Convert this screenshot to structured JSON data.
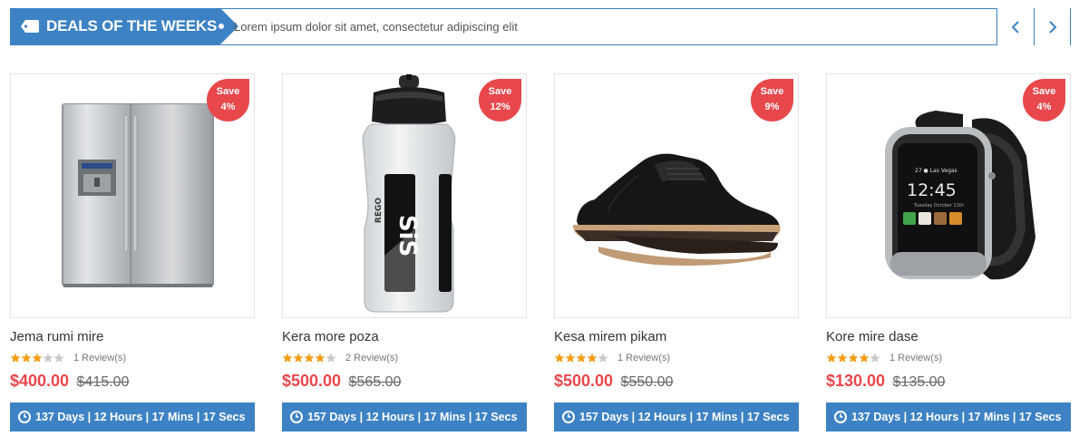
{
  "header": {
    "title": "DEALS OF THE WEEKS",
    "description": "Lorem ipsum dolor sit amet, consectetur adipiscing elit",
    "prev_icon": "chevron-left-icon",
    "next_icon": "chevron-right-icon",
    "tag_icon": "tag-icon"
  },
  "colors": {
    "accent": "#3d82c4",
    "sale": "#e8474c",
    "star_on": "#f39c11",
    "star_off": "#c8c8c8"
  },
  "products": [
    {
      "name": "Jema rumi mire",
      "image": "refrigerator",
      "save_label": "Save",
      "save_pct": "4%",
      "rating": 3,
      "reviews": "1 Review(s)",
      "price": "$400.00",
      "old_price": "$415.00",
      "countdown": "137 Days | 12 Hours | 17 Mins | 17 Secs"
    },
    {
      "name": "Kera more poza",
      "image": "water-bottle",
      "save_label": "Save",
      "save_pct": "12%",
      "rating": 4,
      "reviews": "2 Review(s)",
      "price": "$500.00",
      "old_price": "$565.00",
      "countdown": "157 Days | 12 Hours | 17 Mins | 17 Secs"
    },
    {
      "name": "Kesa mirem pikam",
      "image": "leather-shoe",
      "save_label": "Save",
      "save_pct": "9%",
      "rating": 4,
      "reviews": "1 Review(s)",
      "price": "$500.00",
      "old_price": "$550.00",
      "countdown": "157 Days | 12 Hours | 17 Mins | 17 Secs"
    },
    {
      "name": "Kore mire dase",
      "image": "smartwatch",
      "save_label": "Save",
      "save_pct": "4%",
      "rating": 4,
      "reviews": "1 Review(s)",
      "price": "$130.00",
      "old_price": "$135.00",
      "countdown": "137 Days | 12 Hours | 17 Mins | 17 Secs"
    }
  ],
  "watch_time": "12:45"
}
